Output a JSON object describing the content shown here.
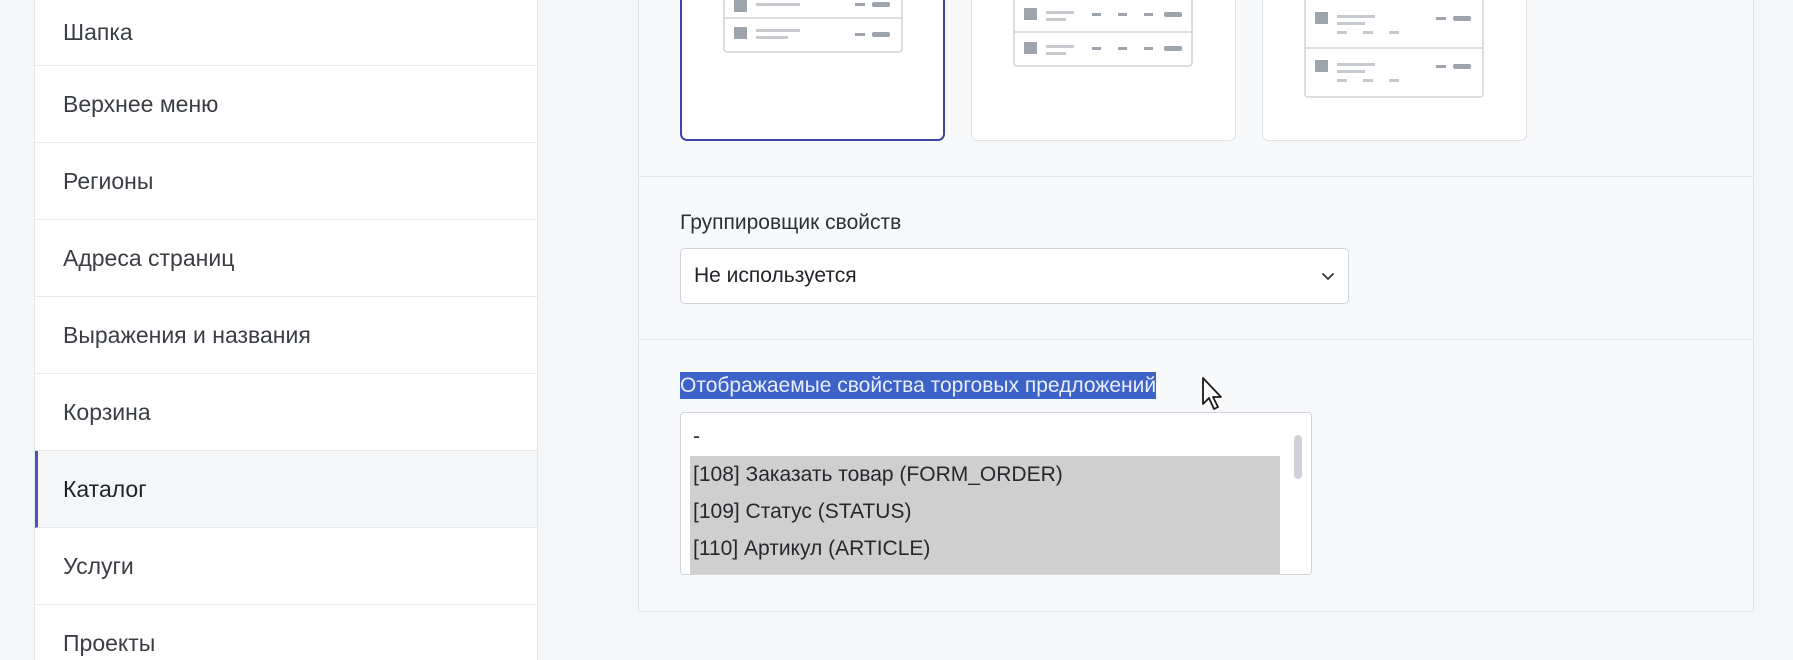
{
  "sidebar": {
    "items": [
      {
        "label": "Шапка",
        "active": false
      },
      {
        "label": "Верхнее меню",
        "active": false
      },
      {
        "label": "Регионы",
        "active": false
      },
      {
        "label": "Адреса страниц",
        "active": false
      },
      {
        "label": "Выражения и названия",
        "active": false
      },
      {
        "label": "Корзина",
        "active": false
      },
      {
        "label": "Каталог",
        "active": true
      },
      {
        "label": "Услуги",
        "active": false
      },
      {
        "label": "Проекты",
        "active": false
      }
    ]
  },
  "layout_options": {
    "selected_index": 0,
    "count": 3
  },
  "grouper": {
    "label": "Группировщик свойств",
    "value": "Не используется"
  },
  "offer_props": {
    "label": "Отображаемые свойства торговых предложений",
    "options": [
      {
        "text": "-",
        "selected": false
      },
      {
        "text": "[108] Заказать товар (FORM_ORDER)",
        "selected": true
      },
      {
        "text": "[109] Статус (STATUS)",
        "selected": true
      },
      {
        "text": "[110] Артикул (ARTICLE)",
        "selected": true
      }
    ]
  },
  "colors": {
    "accent": "#3c47a6",
    "text_highlight": "#3d63c9",
    "option_selected": "#cfcfcf"
  }
}
